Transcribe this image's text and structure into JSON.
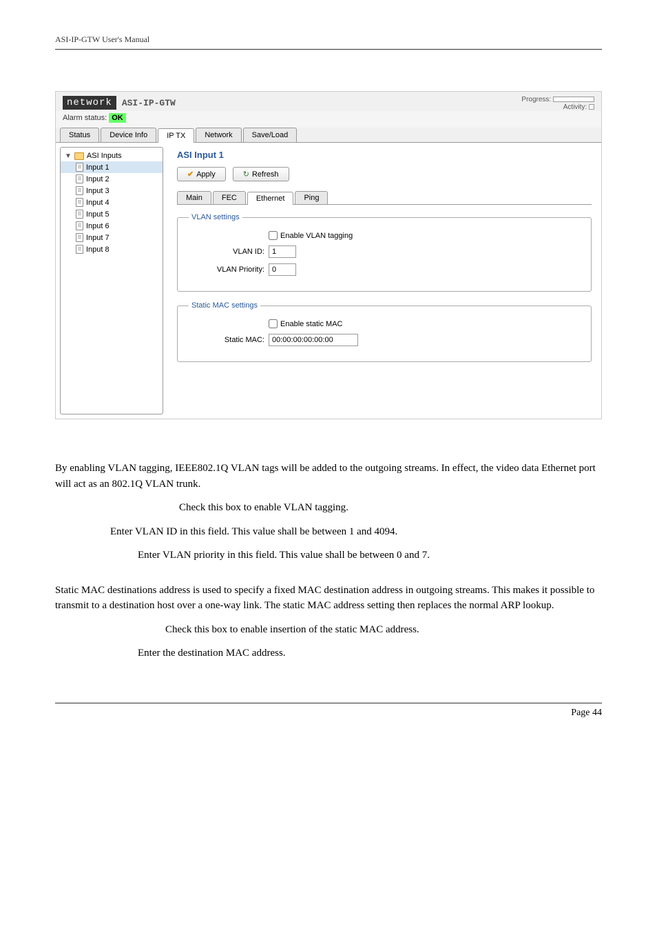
{
  "header": "ASI-IP-GTW User's Manual",
  "window": {
    "brand": "network",
    "model": "ASI-IP-GTW",
    "progress_label": "Progress:",
    "activity_label": "Activity:",
    "alarm_label": "Alarm status:",
    "alarm_status": "OK"
  },
  "tabs": [
    "Status",
    "Device Info",
    "IP TX",
    "Network",
    "Save/Load"
  ],
  "tree": {
    "root": "ASI Inputs",
    "items": [
      "Input 1",
      "Input 2",
      "Input 3",
      "Input 4",
      "Input 5",
      "Input 6",
      "Input 7",
      "Input 8"
    ]
  },
  "panel": {
    "title": "ASI Input 1",
    "apply": "Apply",
    "refresh": "Refresh",
    "subtabs": [
      "Main",
      "FEC",
      "Ethernet",
      "Ping"
    ],
    "vlan": {
      "legend": "VLAN settings",
      "enable_label": "Enable VLAN tagging",
      "id_label": "VLAN ID:",
      "id_value": "1",
      "priority_label": "VLAN Priority:",
      "priority_value": "0"
    },
    "mac": {
      "legend": "Static MAC settings",
      "enable_label": "Enable static MAC",
      "addr_label": "Static MAC:",
      "addr_value": "00:00:00:00:00:00"
    }
  },
  "doc": {
    "p1": "By enabling VLAN tagging, IEEE802.1Q VLAN tags will be added to the outgoing streams. In effect, the video data Ethernet port will act as an 802.1Q VLAN trunk.",
    "p2": "Check this box to enable VLAN tagging.",
    "p3": "Enter VLAN ID in this field. This value shall be between 1 and 4094.",
    "p4": "Enter VLAN priority in this field. This value shall be between 0 and 7.",
    "p5": "Static MAC destinations address is used to specify a fixed MAC destination address in outgoing streams. This makes it possible to transmit to a destination host over a one-way link. The static MAC address setting then replaces the normal ARP lookup.",
    "p6": "Check this box to enable insertion of the static MAC address.",
    "p7": "Enter the destination MAC address."
  },
  "footer": "Page 44"
}
